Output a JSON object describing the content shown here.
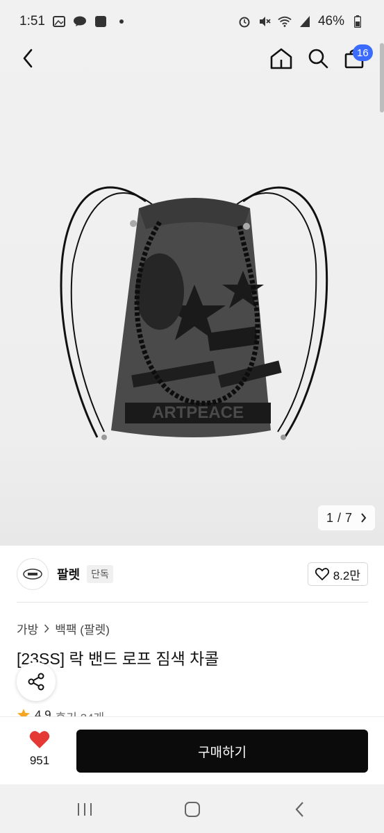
{
  "status_bar": {
    "time": "1:51",
    "battery": "46%",
    "notification_icons": [
      "image-icon",
      "talk-icon",
      "pay-icon",
      "dot-icon"
    ],
    "system_icons": [
      "alarm-icon",
      "mute-icon",
      "wifi-icon",
      "signal-icon",
      "battery-icon"
    ]
  },
  "top_nav": {
    "back_icon": "back-icon",
    "home_icon": "home-icon",
    "search_icon": "search-icon",
    "cart_icon": "cart-icon",
    "cart_count": "16"
  },
  "gallery": {
    "current": "1",
    "separator": "/",
    "total": "7",
    "image_alt": "black drawstring backpack with printed rock-band graphics"
  },
  "store": {
    "name": "팔렛",
    "tag": "단독",
    "likes": "8.2만"
  },
  "breadcrumb": {
    "category": "가방",
    "subcategory": "백팩 (팔렛)"
  },
  "product": {
    "title": "[23SS] 락 밴드 로프 짐색 차콜"
  },
  "rating": {
    "score": "4.9",
    "reviews": "후기 24개"
  },
  "bottom": {
    "wish_count": "951",
    "buy_label": "구매하기"
  },
  "colors": {
    "accent_badge": "#3b6bff",
    "buy_button": "#0b0b0b",
    "heart": "#e53935",
    "star": "#f5a623"
  }
}
